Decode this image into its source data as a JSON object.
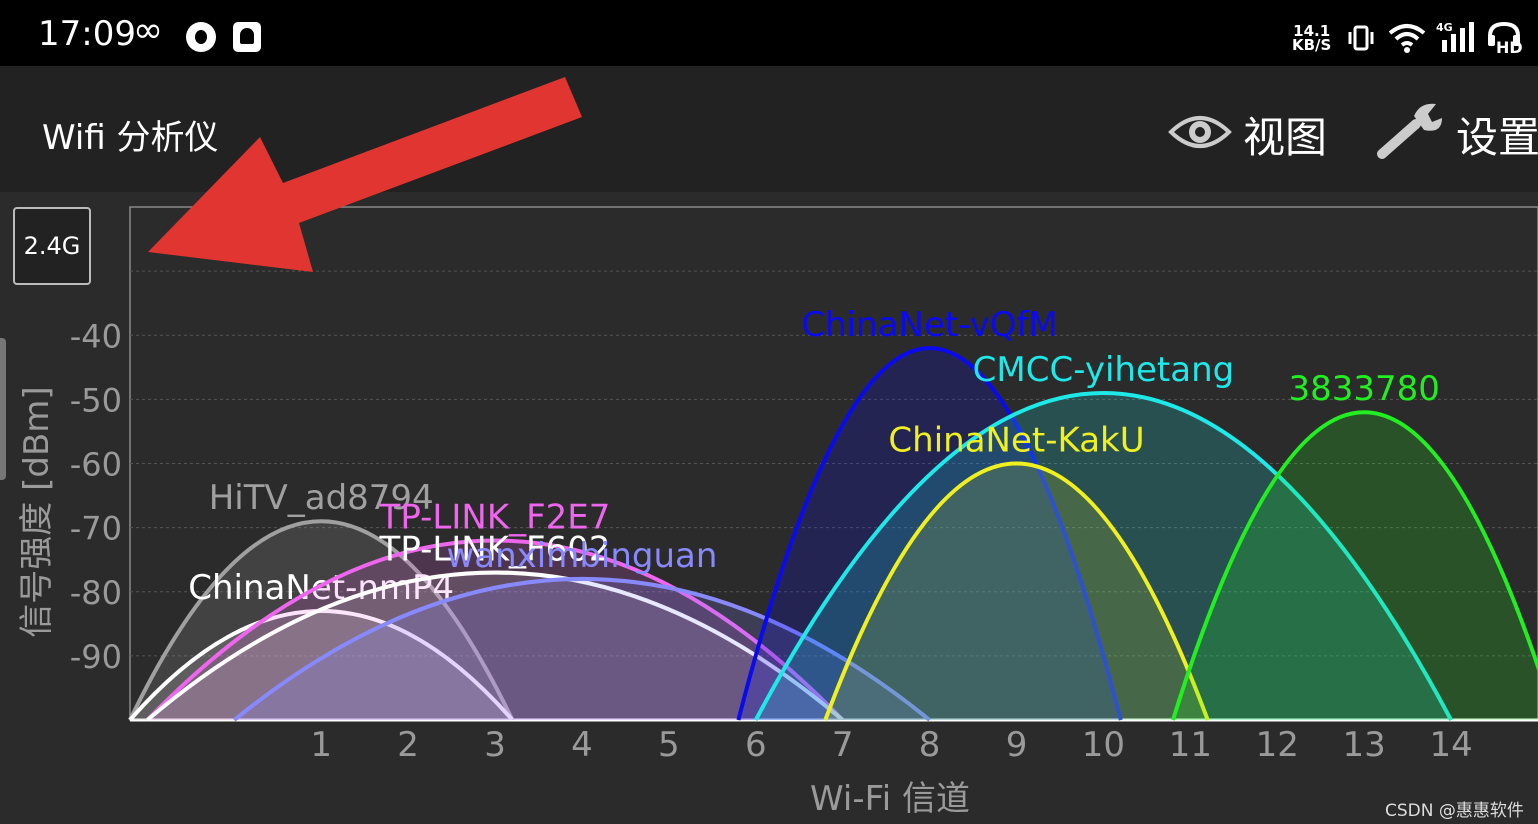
{
  "status_bar": {
    "time": "17:09",
    "network_speed_value": "14.1",
    "network_speed_unit": "KB/S",
    "icons": [
      "infinity-icon",
      "app-notification-icon",
      "app-notification-icon",
      "vibrate-icon",
      "wifi-icon",
      "4g-signal-icon",
      "hd-call-icon"
    ]
  },
  "app_bar": {
    "title": "Wifi 分析仪",
    "view_label": "视图",
    "settings_label": "设置"
  },
  "band_button": "2.4G",
  "annotation": {
    "arrow_color": "#e03530"
  },
  "watermark": "CSDN @惠惠软件",
  "chart_data": {
    "type": "area",
    "xlabel": "Wi-Fi 信道",
    "ylabel": "信号强度 [dBm]",
    "xlim": [
      -1.2,
      15
    ],
    "ylim": [
      -100,
      -20
    ],
    "x_ticks": [
      "1",
      "2",
      "3",
      "4",
      "5",
      "6",
      "7",
      "8",
      "9",
      "10",
      "11",
      "12",
      "13",
      "14"
    ],
    "y_ticks": [
      "-40",
      "-50",
      "-60",
      "-70",
      "-80",
      "-90"
    ],
    "grid": true,
    "series": [
      {
        "name": "HiTV_ad8794",
        "channel": 1,
        "peak": -69,
        "half_width": 2.2,
        "color": "#a0a0a0",
        "fill_alpha": 0.2
      },
      {
        "name": "ChinaNet-nmP4",
        "channel": 1,
        "peak": -83,
        "half_width": 2.2,
        "color": "#ffffff",
        "fill_alpha": 0.15
      },
      {
        "name": "TP-LINK_F2E7",
        "channel": 3,
        "peak": -72,
        "half_width": 4.0,
        "color": "#ee66ee",
        "fill_alpha": 0.18
      },
      {
        "name": "TP-LINK_F602",
        "channel": 3,
        "peak": -77,
        "half_width": 4.0,
        "color": "#ffffff",
        "fill_alpha": 0.12
      },
      {
        "name": "wanximbinguan",
        "channel": 4,
        "peak": -78,
        "half_width": 4.0,
        "color": "#8888ff",
        "fill_alpha": 0.2
      },
      {
        "name": "ChinaNet-vQfM",
        "channel": 8,
        "peak": -42,
        "half_width": 2.2,
        "color": "#0a0aee",
        "fill_alpha": 0.2
      },
      {
        "name": "CMCC-yihetang",
        "channel": 10,
        "peak": -49,
        "half_width": 4.0,
        "color": "#1ee8e8",
        "fill_alpha": 0.2
      },
      {
        "name": "ChinaNet-KakU",
        "channel": 9,
        "peak": -60,
        "half_width": 2.2,
        "color": "#f0f020",
        "fill_alpha": 0.15
      },
      {
        "name": "3833780",
        "channel": 13,
        "peak": -52,
        "half_width": 2.2,
        "color": "#22ee22",
        "fill_alpha": 0.2
      }
    ]
  }
}
